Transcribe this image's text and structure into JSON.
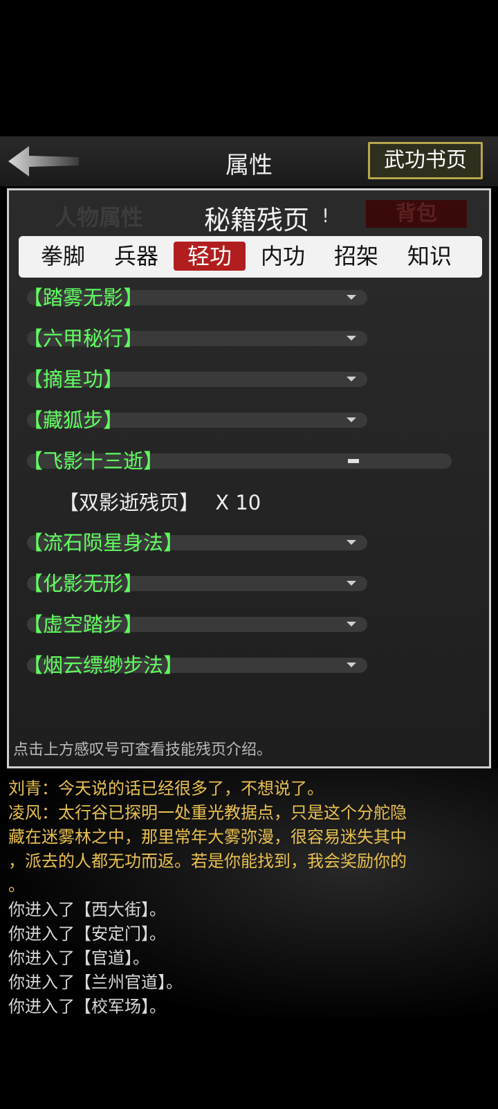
{
  "topbar": {
    "title": "属性",
    "right_button": "武功书页"
  },
  "panel": {
    "tabs_row": {
      "left_tab": "人物属性",
      "center_title": "秘籍残页",
      "excl": "!",
      "right_tab": "背包"
    },
    "categories": [
      "拳脚",
      "兵器",
      "轻功",
      "内功",
      "招架",
      "知识"
    ],
    "active_category": "轻功",
    "skills": [
      {
        "name": "【踏雾无影】",
        "state": "collapsed"
      },
      {
        "name": "【六甲秘行】",
        "state": "collapsed"
      },
      {
        "name": "【摘星功】",
        "state": "collapsed"
      },
      {
        "name": "【藏狐步】",
        "state": "collapsed"
      },
      {
        "name": "【飞影十三逝】",
        "state": "expanded"
      },
      {
        "name": "【流石陨星身法】",
        "state": "collapsed"
      },
      {
        "name": "【化影无形】",
        "state": "collapsed"
      },
      {
        "name": "【虚空踏步】",
        "state": "collapsed"
      },
      {
        "name": "【烟云缥缈步法】",
        "state": "collapsed"
      }
    ],
    "expanded_item": {
      "name": "【双影逝残页】",
      "count": "X 10"
    },
    "hint": "点击上方感叹号可查看技能残页介绍。"
  },
  "log": [
    {
      "text": "刘青：今天说的话已经很多了，不想说了。",
      "color": "gold"
    },
    {
      "text": "凌风：太行谷已探明一处重光教据点，只是这个分舵隐",
      "color": "gold"
    },
    {
      "text": "藏在迷雾林之中，那里常年大雾弥漫，很容易迷失其中",
      "color": "gold"
    },
    {
      "text": "，派去的人都无功而返。若是你能找到，我会奖励你的",
      "color": "gold"
    },
    {
      "text": "。",
      "color": "gold"
    },
    {
      "text": "你进入了【西大街】。",
      "color": "white"
    },
    {
      "text": "你进入了【安定门】。",
      "color": "white"
    },
    {
      "text": "你进入了【官道】。",
      "color": "white"
    },
    {
      "text": "你进入了【兰州官道】。",
      "color": "white"
    },
    {
      "text": "你进入了【校军场】。",
      "color": "white"
    }
  ]
}
